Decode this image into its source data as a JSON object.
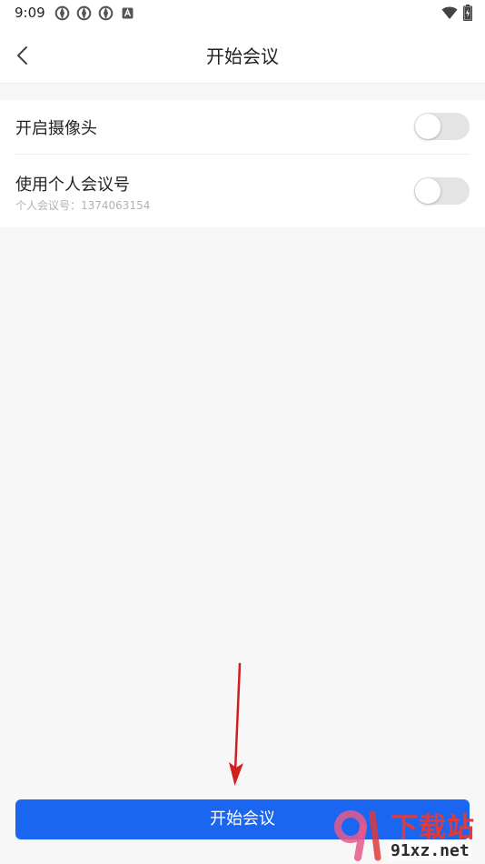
{
  "status_bar": {
    "time": "9:09",
    "icons_left": [
      "app-notification-icon",
      "app-notification-icon",
      "app-notification-icon",
      "a-icon"
    ],
    "icons_right": [
      "wifi-icon",
      "battery-charging-icon"
    ]
  },
  "header": {
    "title": "开始会议",
    "back_icon": "chevron-left-icon"
  },
  "settings": {
    "camera": {
      "label": "开启摄像头",
      "enabled": false
    },
    "personal_meeting_id": {
      "label": "使用个人会议号",
      "subtitle": "个人会议号：1374063154",
      "enabled": false
    }
  },
  "actions": {
    "start_meeting_label": "开始会议"
  },
  "watermark": {
    "top_text": "下载站",
    "bottom_text": "91xz.net"
  },
  "colors": {
    "primary": "#1a66f0",
    "page_background": "#f7f7f7",
    "toggle_off": "#e4e4e4",
    "annotation_arrow": "#d11f1f"
  }
}
